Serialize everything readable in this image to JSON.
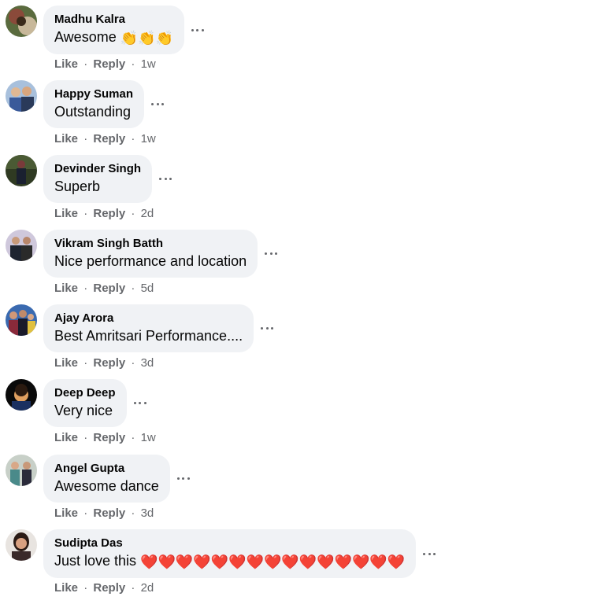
{
  "actions": {
    "like": "Like",
    "reply": "Reply",
    "separator": "·"
  },
  "comments": [
    {
      "author": "Madhu Kalra",
      "text": "Awesome",
      "emoji": "👏👏👏",
      "time": "1w",
      "avatar_color": "#7a4a3a"
    },
    {
      "author": "Happy Suman",
      "text": "Outstanding",
      "emoji": "",
      "time": "1w",
      "avatar_color": "#4a6fa5"
    },
    {
      "author": "Devinder Singh",
      "text": "Superb",
      "emoji": "",
      "time": "2d",
      "avatar_color": "#3b4a2a"
    },
    {
      "author": "Vikram Singh Batth",
      "text": "Nice performance and location",
      "emoji": "",
      "time": "5d",
      "avatar_color": "#b9b4c8"
    },
    {
      "author": "Ajay Arora",
      "text": "Best Amritsari Performance....",
      "emoji": "",
      "time": "3d",
      "avatar_color": "#2c4a8a"
    },
    {
      "author": "Deep Deep",
      "text": "Very nice",
      "emoji": "",
      "time": "1w",
      "avatar_color": "#111111"
    },
    {
      "author": "Angel Gupta",
      "text": "Awesome dance",
      "emoji": "",
      "time": "3d",
      "avatar_color": "#9aa59a"
    },
    {
      "author": "Sudipta Das",
      "text": "Just love this",
      "emoji": "❤️❤️❤️❤️❤️❤️❤️❤️❤️❤️❤️❤️❤️❤️❤️",
      "time": "2d",
      "avatar_color": "#6b4a3a"
    }
  ]
}
